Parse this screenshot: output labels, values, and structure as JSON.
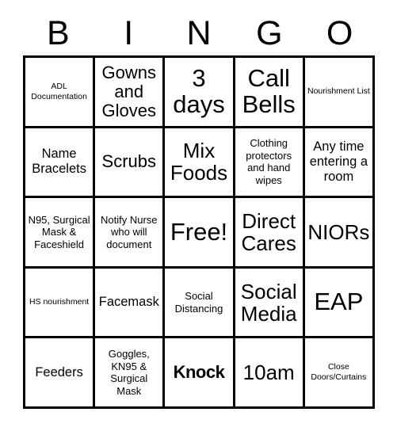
{
  "card": {
    "title_letters": [
      "B",
      "I",
      "N",
      "G",
      "O"
    ],
    "free_space_label": "Free!",
    "columns": 5,
    "rows": 5,
    "border_color": "#000000",
    "background_color": "#ffffff",
    "text_color": "#000000"
  },
  "squares": [
    [
      {
        "text": "ADL Documentation",
        "size": "sz-xs",
        "bold": false
      },
      {
        "text": "Gowns and Gloves",
        "size": "sz-lg",
        "bold": false
      },
      {
        "text": "3 days",
        "size": "sz-xxl",
        "bold": false
      },
      {
        "text": "Call Bells",
        "size": "sz-xxl",
        "bold": false
      },
      {
        "text": "Nourishment List",
        "size": "sz-xs",
        "bold": false
      }
    ],
    [
      {
        "text": "Name Bracelets",
        "size": "sz-md",
        "bold": false
      },
      {
        "text": "Scrubs",
        "size": "sz-lg",
        "bold": false
      },
      {
        "text": "Mix Foods",
        "size": "sz-xl",
        "bold": false
      },
      {
        "text": "Clothing protectors and hand wipes",
        "size": "sz-sm",
        "bold": false
      },
      {
        "text": "Any time entering a room",
        "size": "sz-md",
        "bold": false
      }
    ],
    [
      {
        "text": "N95, Surgical Mask & Faceshield",
        "size": "sz-sm",
        "bold": false
      },
      {
        "text": "Notify Nurse who will document",
        "size": "sz-sm",
        "bold": false
      },
      {
        "text": "Free!",
        "size": "sz-xxl",
        "bold": false
      },
      {
        "text": "Direct Cares",
        "size": "sz-xl",
        "bold": false
      },
      {
        "text": "NIORs",
        "size": "sz-xl",
        "bold": false
      }
    ],
    [
      {
        "text": "HS nourishment",
        "size": "sz-xs",
        "bold": false
      },
      {
        "text": "Facemask",
        "size": "sz-md",
        "bold": false
      },
      {
        "text": "Social Distancing",
        "size": "sz-sm",
        "bold": false
      },
      {
        "text": "Social Media",
        "size": "sz-xl",
        "bold": false
      },
      {
        "text": "EAP",
        "size": "sz-xxl",
        "bold": false
      }
    ],
    [
      {
        "text": "Feeders",
        "size": "sz-md",
        "bold": false
      },
      {
        "text": "Goggles, KN95 & Surgical Mask",
        "size": "sz-sm",
        "bold": false
      },
      {
        "text": "Knock",
        "size": "sz-lg",
        "bold": true
      },
      {
        "text": "10am",
        "size": "sz-xl",
        "bold": false
      },
      {
        "text": "Close Doors/Curtains",
        "size": "sz-xs",
        "bold": false
      }
    ]
  ]
}
